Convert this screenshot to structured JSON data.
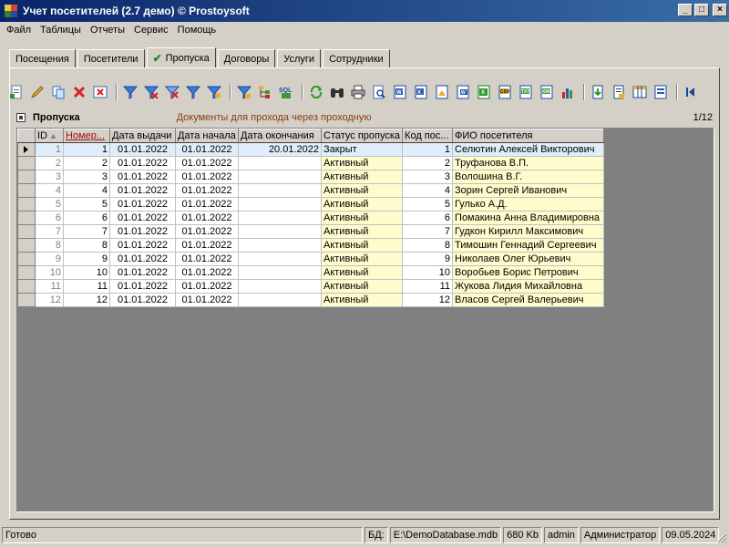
{
  "window": {
    "title": "Учет посетителей (2.7 демо) © Prostoysoft",
    "buttons": {
      "minimize": "_",
      "maximize": "□",
      "close": "×"
    }
  },
  "menu": [
    {
      "label": "Файл"
    },
    {
      "label": "Таблицы"
    },
    {
      "label": "Отчеты"
    },
    {
      "label": "Сервис"
    },
    {
      "label": "Помощь"
    }
  ],
  "tabs": [
    {
      "label": "Посещения",
      "active": false
    },
    {
      "label": "Посетители",
      "active": false
    },
    {
      "label": "Пропуска",
      "active": true
    },
    {
      "label": "Договоры",
      "active": false
    },
    {
      "label": "Услуги",
      "active": false
    },
    {
      "label": "Сотрудники",
      "active": false
    }
  ],
  "toolbar": [
    {
      "icon": "new-document-icon"
    },
    {
      "icon": "edit-pencil-icon"
    },
    {
      "icon": "copy-icon"
    },
    {
      "icon": "delete-x-icon"
    },
    {
      "icon": "delete-table-icon"
    },
    {
      "sep": true
    },
    {
      "icon": "filter-icon"
    },
    {
      "icon": "filter-clear-icon"
    },
    {
      "icon": "filter-remove-icon"
    },
    {
      "icon": "filter-edit-icon"
    },
    {
      "icon": "filter-settings-icon"
    },
    {
      "sep": true
    },
    {
      "icon": "filter-advanced-icon"
    },
    {
      "icon": "tree-icon"
    },
    {
      "icon": "sql-icon"
    },
    {
      "sep": true
    },
    {
      "icon": "refresh-icon"
    },
    {
      "icon": "search-binoculars-icon"
    },
    {
      "icon": "print-icon"
    },
    {
      "icon": "print-preview-icon"
    },
    {
      "icon": "export-word-icon"
    },
    {
      "icon": "export-excel-icon"
    },
    {
      "icon": "export-image-icon"
    },
    {
      "icon": "export-rtf-icon"
    },
    {
      "icon": "export-xls-icon"
    },
    {
      "icon": "export-csv-icon"
    },
    {
      "icon": "export-txt-icon"
    },
    {
      "icon": "export-html-icon"
    },
    {
      "icon": "chart-icon"
    },
    {
      "sep": true
    },
    {
      "icon": "import-icon"
    },
    {
      "icon": "report-icon"
    },
    {
      "icon": "columns-icon"
    },
    {
      "icon": "settings-icon"
    },
    {
      "sep": true
    },
    {
      "icon": "nav-first-icon"
    }
  ],
  "grid_header": {
    "title": "Пропуска",
    "subtitle": "Документы для прохода через проходную",
    "count": "1/12"
  },
  "columns": [
    {
      "label": "ID",
      "sort": "▲"
    },
    {
      "label": "Номер..."
    },
    {
      "label": "Дата выдачи"
    },
    {
      "label": "Дата начала"
    },
    {
      "label": "Дата окончания"
    },
    {
      "label": "Статус пропуска"
    },
    {
      "label": "Код пос..."
    },
    {
      "label": "ФИО посетителя"
    }
  ],
  "rows": [
    {
      "id": "1",
      "num": "1",
      "issued": "01.01.2022",
      "start": "01.01.2022",
      "end": "20.01.2022",
      "status": "Закрыт",
      "code": "1",
      "fio": "Селютин Алексей Викторович",
      "selected": true
    },
    {
      "id": "2",
      "num": "2",
      "issued": "01.01.2022",
      "start": "01.01.2022",
      "end": "",
      "status": "Активный",
      "code": "2",
      "fio": "Труфанова В.П."
    },
    {
      "id": "3",
      "num": "3",
      "issued": "01.01.2022",
      "start": "01.01.2022",
      "end": "",
      "status": "Активный",
      "code": "3",
      "fio": "Волошина В.Г."
    },
    {
      "id": "4",
      "num": "4",
      "issued": "01.01.2022",
      "start": "01.01.2022",
      "end": "",
      "status": "Активный",
      "code": "4",
      "fio": "Зорин Сергей Иванович"
    },
    {
      "id": "5",
      "num": "5",
      "issued": "01.01.2022",
      "start": "01.01.2022",
      "end": "",
      "status": "Активный",
      "code": "5",
      "fio": "Гулько А.Д."
    },
    {
      "id": "6",
      "num": "6",
      "issued": "01.01.2022",
      "start": "01.01.2022",
      "end": "",
      "status": "Активный",
      "code": "6",
      "fio": "Помакина Анна Владимировна"
    },
    {
      "id": "7",
      "num": "7",
      "issued": "01.01.2022",
      "start": "01.01.2022",
      "end": "",
      "status": "Активный",
      "code": "7",
      "fio": "Гудкон Кирилл Максимович"
    },
    {
      "id": "8",
      "num": "8",
      "issued": "01.01.2022",
      "start": "01.01.2022",
      "end": "",
      "status": "Активный",
      "code": "8",
      "fio": "Тимошин Геннадий Сергеевич"
    },
    {
      "id": "9",
      "num": "9",
      "issued": "01.01.2022",
      "start": "01.01.2022",
      "end": "",
      "status": "Активный",
      "code": "9",
      "fio": "Николаев Олег Юрьевич"
    },
    {
      "id": "10",
      "num": "10",
      "issued": "01.01.2022",
      "start": "01.01.2022",
      "end": "",
      "status": "Активный",
      "code": "10",
      "fio": "Воробьев Борис Петрович"
    },
    {
      "id": "11",
      "num": "11",
      "issued": "01.01.2022",
      "start": "01.01.2022",
      "end": "",
      "status": "Активный",
      "code": "11",
      "fio": "Жукова Лидия Михайловна"
    },
    {
      "id": "12",
      "num": "12",
      "issued": "01.01.2022",
      "start": "01.01.2022",
      "end": "",
      "status": "Активный",
      "code": "12",
      "fio": "Власов Сергей Валерьевич"
    }
  ],
  "statusbar": {
    "status": "Готово",
    "db_label": "БД:",
    "db_path": "E:\\DemoDatabase.mdb",
    "db_size": "680 Kb",
    "user": "admin",
    "role": "Администратор",
    "date": "09.05.2024"
  },
  "colors": {
    "titlebar_start": "#0a246a",
    "titlebar_end": "#3a6ea5",
    "status_cell_bg": "#fffccc",
    "selected_row_bg": "#dfeefa",
    "subtitle_color": "#8a3c10"
  }
}
